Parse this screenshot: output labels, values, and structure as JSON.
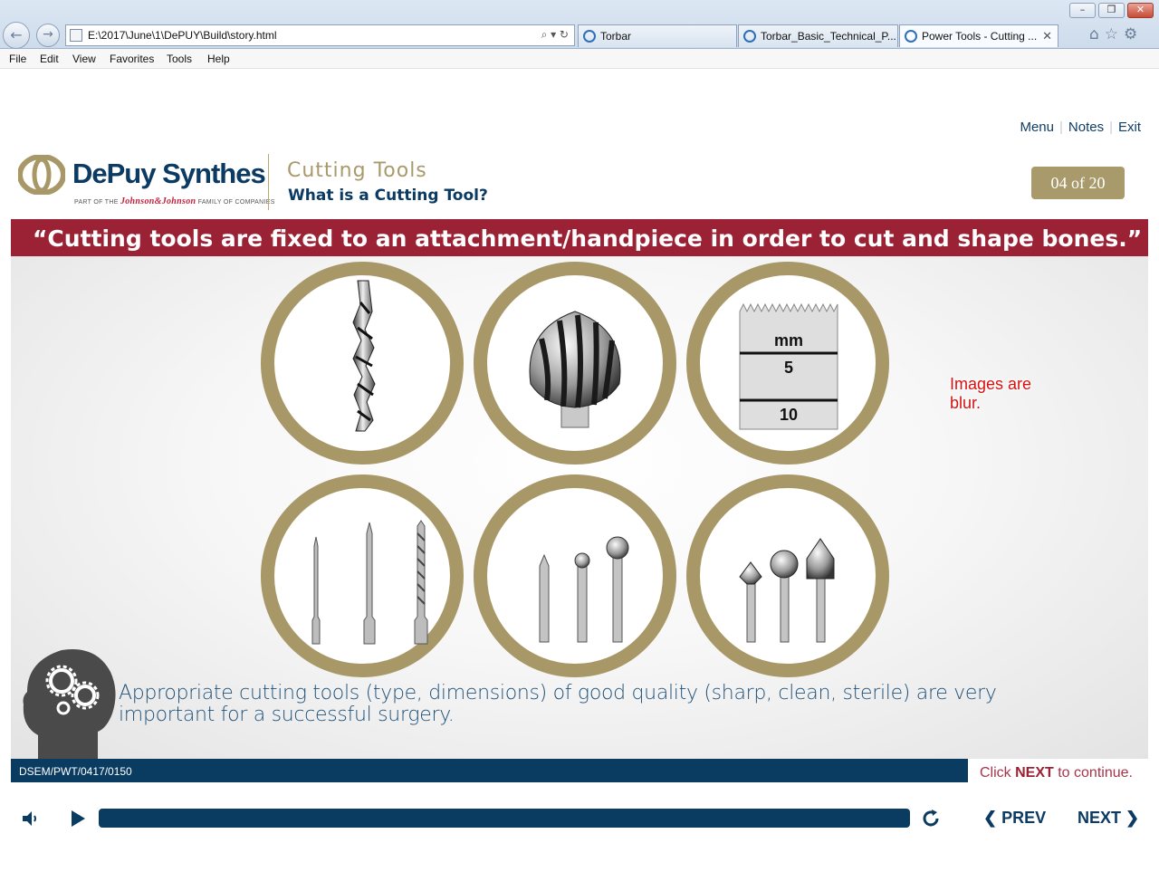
{
  "browser": {
    "url": "E:\\2017\\June\\1\\DePUY\\Build\\story.html",
    "tabs": [
      {
        "title": "Torbar"
      },
      {
        "title": "Torbar_Basic_Technical_P..."
      },
      {
        "title": "Power Tools - Cutting ..."
      }
    ],
    "menu": [
      "File",
      "Edit",
      "View",
      "Favorites",
      "Tools",
      "Help"
    ]
  },
  "player": {
    "links": {
      "menu": "Menu",
      "notes": "Notes",
      "exit": "Exit"
    },
    "logo": {
      "name": "DePuy Synthes",
      "tagline_pre": "PART OF THE",
      "tagline_brand": "Johnson&Johnson",
      "tagline_post": "FAMILY OF COMPANIES"
    },
    "course_title": "Cutting Tools",
    "lesson_title": "What is a Cutting Tool?",
    "page_counter": "04 of 20"
  },
  "slide": {
    "quote": "“Cutting tools are fixed to an attachment/handpiece in order to cut and shape bones.”",
    "tools": [
      {
        "icon": "drill-bit-icon"
      },
      {
        "icon": "large-burr-icon"
      },
      {
        "icon": "saw-blade-icon",
        "label_unit": "mm",
        "label_a": "5",
        "label_b": "10"
      },
      {
        "icon": "drill-bits-set-icon"
      },
      {
        "icon": "ball-burrs-icon"
      },
      {
        "icon": "shaped-burrs-icon"
      }
    ],
    "annotation": "Images are blur.",
    "tip": "Appropriate cutting tools (type, dimensions) of good quality (sharp, clean, sterile) are very important for a successful surgery."
  },
  "footer": {
    "code": "DSEM/PWT/0417/0150",
    "click_pre": "Click ",
    "click_next": "NEXT",
    "click_post": " to continue."
  },
  "controls": {
    "prev": "PREV",
    "next": "NEXT"
  },
  "colors": {
    "navy": "#0a3c61",
    "gold": "#a89868",
    "crimson": "#9b2134"
  }
}
